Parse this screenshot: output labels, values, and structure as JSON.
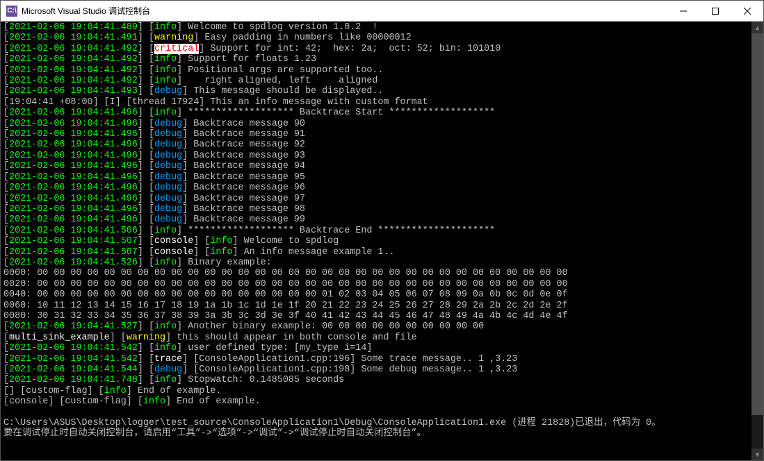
{
  "window": {
    "title": "Microsoft Visual Studio 调试控制台",
    "icon_text": "C:\\"
  },
  "log": {
    "l1": {
      "ts": "2021-02-06 19:04:41.489",
      "lvl": "info",
      "msg": "Welcome to spdlog version 1.8.2  !"
    },
    "l2": {
      "ts": "2021-02-06 19:04:41.491",
      "lvl": "warning",
      "msg": "Easy padding in numbers like 00000012"
    },
    "l3": {
      "ts": "2021-02-06 19:04:41.492",
      "lvl": "critical",
      "msg": "Support for int: 42;  hex: 2a;  oct: 52; bin: 101010"
    },
    "l4": {
      "ts": "2021-02-06 19:04:41.492",
      "lvl": "info",
      "msg": "Support for floats 1.23"
    },
    "l5": {
      "ts": "2021-02-06 19:04:41.492",
      "lvl": "info",
      "msg": "Positional args are supported too.."
    },
    "l6": {
      "ts": "2021-02-06 19:04:41.492",
      "lvl": "info",
      "msg": "   right aligned, left     aligned"
    },
    "l7": {
      "ts": "2021-02-06 19:04:41.493",
      "lvl": "debug",
      "msg": "This message should be displayed.."
    },
    "l8": {
      "raw": "[19:04:41 +08:00] [I] [thread 17924] This an info message with custom format"
    },
    "l9": {
      "ts": "2021-02-06 19:04:41.496",
      "lvl": "info",
      "msg": "******************* Backtrace Start *******************"
    },
    "l10": {
      "ts": "2021-02-06 19:04:41.496",
      "lvl": "debug",
      "msg": "Backtrace message 90"
    },
    "l11": {
      "ts": "2021-02-06 19:04:41.496",
      "lvl": "debug",
      "msg": "Backtrace message 91"
    },
    "l12": {
      "ts": "2021-02-06 19:04:41.496",
      "lvl": "debug",
      "msg": "Backtrace message 92"
    },
    "l13": {
      "ts": "2021-02-06 19:04:41.496",
      "lvl": "debug",
      "msg": "Backtrace message 93"
    },
    "l14": {
      "ts": "2021-02-06 19:04:41.496",
      "lvl": "debug",
      "msg": "Backtrace message 94"
    },
    "l15": {
      "ts": "2021-02-06 19:04:41.496",
      "lvl": "debug",
      "msg": "Backtrace message 95"
    },
    "l16": {
      "ts": "2021-02-06 19:04:41.496",
      "lvl": "debug",
      "msg": "Backtrace message 96"
    },
    "l17": {
      "ts": "2021-02-06 19:04:41.496",
      "lvl": "debug",
      "msg": "Backtrace message 97"
    },
    "l18": {
      "ts": "2021-02-06 19:04:41.496",
      "lvl": "debug",
      "msg": "Backtrace message 98"
    },
    "l19": {
      "ts": "2021-02-06 19:04:41.496",
      "lvl": "debug",
      "msg": "Backtrace message 99"
    },
    "l20": {
      "ts": "2021-02-06 19:04:41.506",
      "lvl": "info",
      "msg": "******************* Backtrace End *********************"
    },
    "l21": {
      "ts": "2021-02-06 19:04:41.507",
      "chan": "console",
      "lvl": "info",
      "msg": "Welcome to spdlog"
    },
    "l22": {
      "ts": "2021-02-06 19:04:41.507",
      "chan": "console",
      "lvl": "info",
      "msg": "An info message example 1.."
    },
    "l23": {
      "ts": "2021-02-06 19:04:41.526",
      "lvl": "info",
      "msg": "Binary example:"
    },
    "hex1": "0000: 00 00 00 00 00 00 00 00 00 00 00 00 00 00 00 00 00 00 00 00 00 00 00 00 00 00 00 00 00 00 00 00",
    "hex2": "0020: 00 00 00 00 00 00 00 00 00 00 00 00 00 00 00 00 00 00 00 00 00 00 00 00 00 00 00 00 00 00 00 00",
    "hex3": "0040: 00 00 00 00 00 00 00 00 00 00 00 00 00 00 00 00 00 01 02 03 04 05 06 07 08 09 0a 0b 0c 0d 0e 0f",
    "hex4": "0060: 10 11 12 13 14 15 16 17 18 19 1a 1b 1c 1d 1e 1f 20 21 22 23 24 25 26 27 28 29 2a 2b 2c 2d 2e 2f",
    "hex5": "0080: 30 31 32 33 34 35 36 37 38 39 3a 3b 3c 3d 3e 3f 40 41 42 43 44 45 46 47 48 49 4a 4b 4c 4d 4e 4f",
    "l24": {
      "ts": "2021-02-06 19:04:41.527",
      "lvl": "info",
      "msg": "Another binary example: 00 00 00 00 00 00 00 00 00 00"
    },
    "l25": {
      "chan": "multi_sink_example",
      "lvl": "warning",
      "msg": "this should appear in both console and file"
    },
    "l26": {
      "ts": "2021-02-06 19:04:41.542",
      "lvl": "info",
      "msg": "user defined type: [my_type i=14]"
    },
    "l27": {
      "ts": "2021-02-06 19:04:41.542",
      "lvl": "trace",
      "msg": "[ConsoleApplication1.cpp:196] Some trace message.. 1 ,3.23"
    },
    "l28": {
      "ts": "2021-02-06 19:04:41.544",
      "lvl": "debug",
      "msg": "[ConsoleApplication1.cpp:198] Some debug message.. 1 ,3.23"
    },
    "l29": {
      "ts": "2021-02-06 19:04:41.748",
      "lvl": "info",
      "msg": "Stopwatch: 0.1485085 seconds"
    },
    "l30": {
      "chan2": "[] [custom-flag]",
      "lvl": "info",
      "msg": "End of example."
    },
    "l31": {
      "chan2": "[console] [custom-flag]",
      "lvl": "info",
      "msg": "End of example."
    },
    "foot1": "C:\\Users\\ASUS\\Desktop\\logger\\test_source\\ConsoleApplication1\\Debug\\ConsoleApplication1.exe (进程 21828)已退出，代码为 0。",
    "foot2": "要在调试停止时自动关闭控制台，请启用“工具”->“选项”->“调试”->“调试停止时自动关闭控制台”。"
  }
}
